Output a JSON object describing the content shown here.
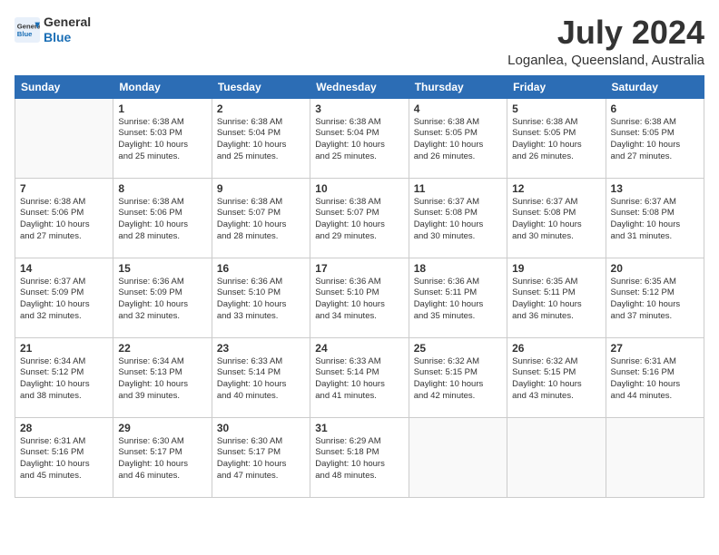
{
  "header": {
    "logo_line1": "General",
    "logo_line2": "Blue",
    "month_year": "July 2024",
    "location": "Loganlea, Queensland, Australia"
  },
  "days_of_week": [
    "Sunday",
    "Monday",
    "Tuesday",
    "Wednesday",
    "Thursday",
    "Friday",
    "Saturday"
  ],
  "weeks": [
    [
      {
        "day": "",
        "info": ""
      },
      {
        "day": "1",
        "info": "Sunrise: 6:38 AM\nSunset: 5:03 PM\nDaylight: 10 hours\nand 25 minutes."
      },
      {
        "day": "2",
        "info": "Sunrise: 6:38 AM\nSunset: 5:04 PM\nDaylight: 10 hours\nand 25 minutes."
      },
      {
        "day": "3",
        "info": "Sunrise: 6:38 AM\nSunset: 5:04 PM\nDaylight: 10 hours\nand 25 minutes."
      },
      {
        "day": "4",
        "info": "Sunrise: 6:38 AM\nSunset: 5:05 PM\nDaylight: 10 hours\nand 26 minutes."
      },
      {
        "day": "5",
        "info": "Sunrise: 6:38 AM\nSunset: 5:05 PM\nDaylight: 10 hours\nand 26 minutes."
      },
      {
        "day": "6",
        "info": "Sunrise: 6:38 AM\nSunset: 5:05 PM\nDaylight: 10 hours\nand 27 minutes."
      }
    ],
    [
      {
        "day": "7",
        "info": "Sunrise: 6:38 AM\nSunset: 5:06 PM\nDaylight: 10 hours\nand 27 minutes."
      },
      {
        "day": "8",
        "info": "Sunrise: 6:38 AM\nSunset: 5:06 PM\nDaylight: 10 hours\nand 28 minutes."
      },
      {
        "day": "9",
        "info": "Sunrise: 6:38 AM\nSunset: 5:07 PM\nDaylight: 10 hours\nand 28 minutes."
      },
      {
        "day": "10",
        "info": "Sunrise: 6:38 AM\nSunset: 5:07 PM\nDaylight: 10 hours\nand 29 minutes."
      },
      {
        "day": "11",
        "info": "Sunrise: 6:37 AM\nSunset: 5:08 PM\nDaylight: 10 hours\nand 30 minutes."
      },
      {
        "day": "12",
        "info": "Sunrise: 6:37 AM\nSunset: 5:08 PM\nDaylight: 10 hours\nand 30 minutes."
      },
      {
        "day": "13",
        "info": "Sunrise: 6:37 AM\nSunset: 5:08 PM\nDaylight: 10 hours\nand 31 minutes."
      }
    ],
    [
      {
        "day": "14",
        "info": "Sunrise: 6:37 AM\nSunset: 5:09 PM\nDaylight: 10 hours\nand 32 minutes."
      },
      {
        "day": "15",
        "info": "Sunrise: 6:36 AM\nSunset: 5:09 PM\nDaylight: 10 hours\nand 32 minutes."
      },
      {
        "day": "16",
        "info": "Sunrise: 6:36 AM\nSunset: 5:10 PM\nDaylight: 10 hours\nand 33 minutes."
      },
      {
        "day": "17",
        "info": "Sunrise: 6:36 AM\nSunset: 5:10 PM\nDaylight: 10 hours\nand 34 minutes."
      },
      {
        "day": "18",
        "info": "Sunrise: 6:36 AM\nSunset: 5:11 PM\nDaylight: 10 hours\nand 35 minutes."
      },
      {
        "day": "19",
        "info": "Sunrise: 6:35 AM\nSunset: 5:11 PM\nDaylight: 10 hours\nand 36 minutes."
      },
      {
        "day": "20",
        "info": "Sunrise: 6:35 AM\nSunset: 5:12 PM\nDaylight: 10 hours\nand 37 minutes."
      }
    ],
    [
      {
        "day": "21",
        "info": "Sunrise: 6:34 AM\nSunset: 5:12 PM\nDaylight: 10 hours\nand 38 minutes."
      },
      {
        "day": "22",
        "info": "Sunrise: 6:34 AM\nSunset: 5:13 PM\nDaylight: 10 hours\nand 39 minutes."
      },
      {
        "day": "23",
        "info": "Sunrise: 6:33 AM\nSunset: 5:14 PM\nDaylight: 10 hours\nand 40 minutes."
      },
      {
        "day": "24",
        "info": "Sunrise: 6:33 AM\nSunset: 5:14 PM\nDaylight: 10 hours\nand 41 minutes."
      },
      {
        "day": "25",
        "info": "Sunrise: 6:32 AM\nSunset: 5:15 PM\nDaylight: 10 hours\nand 42 minutes."
      },
      {
        "day": "26",
        "info": "Sunrise: 6:32 AM\nSunset: 5:15 PM\nDaylight: 10 hours\nand 43 minutes."
      },
      {
        "day": "27",
        "info": "Sunrise: 6:31 AM\nSunset: 5:16 PM\nDaylight: 10 hours\nand 44 minutes."
      }
    ],
    [
      {
        "day": "28",
        "info": "Sunrise: 6:31 AM\nSunset: 5:16 PM\nDaylight: 10 hours\nand 45 minutes."
      },
      {
        "day": "29",
        "info": "Sunrise: 6:30 AM\nSunset: 5:17 PM\nDaylight: 10 hours\nand 46 minutes."
      },
      {
        "day": "30",
        "info": "Sunrise: 6:30 AM\nSunset: 5:17 PM\nDaylight: 10 hours\nand 47 minutes."
      },
      {
        "day": "31",
        "info": "Sunrise: 6:29 AM\nSunset: 5:18 PM\nDaylight: 10 hours\nand 48 minutes."
      },
      {
        "day": "",
        "info": ""
      },
      {
        "day": "",
        "info": ""
      },
      {
        "day": "",
        "info": ""
      }
    ]
  ]
}
